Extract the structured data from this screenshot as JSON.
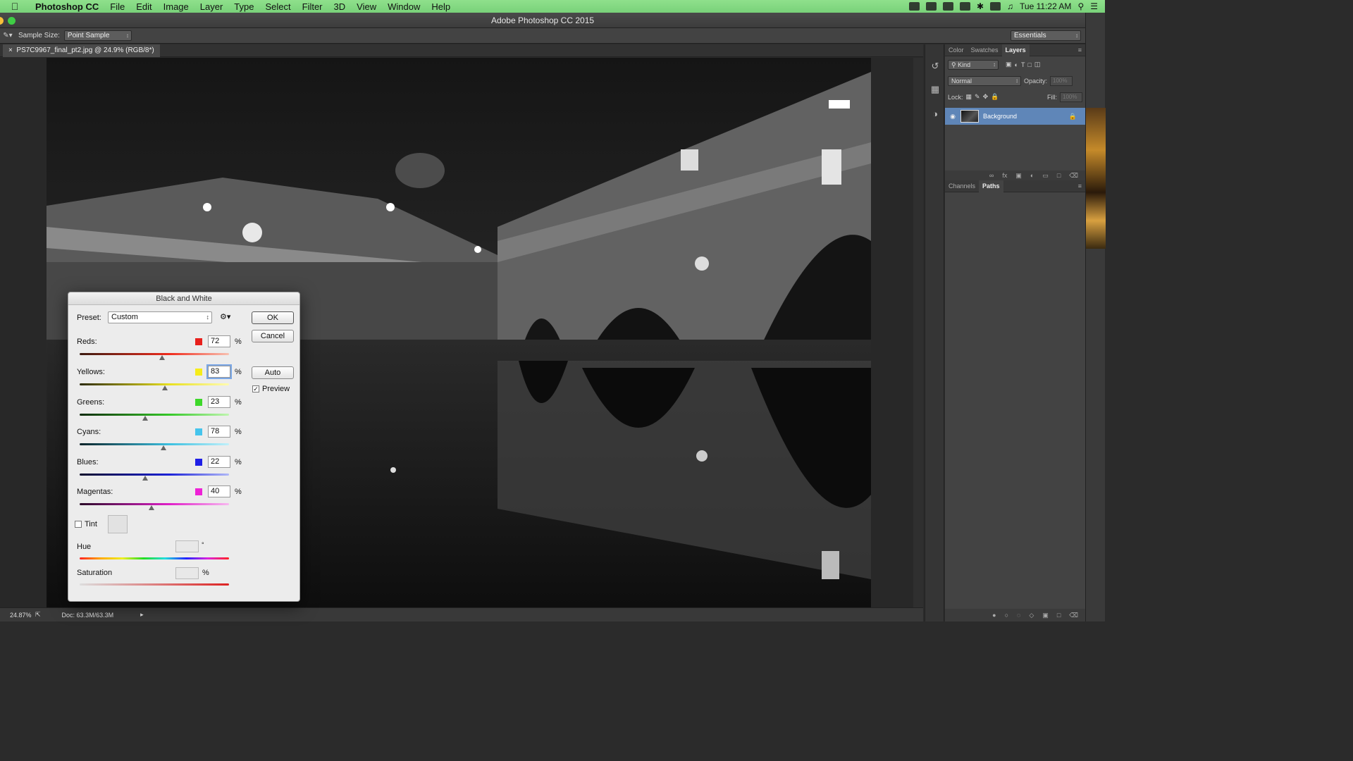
{
  "menubar": {
    "app_name": "Photoshop CC",
    "menus": [
      "File",
      "Edit",
      "Image",
      "Layer",
      "Type",
      "Select",
      "Filter",
      "3D",
      "View",
      "Window",
      "Help"
    ],
    "clock": "Tue 11:22 AM"
  },
  "window": {
    "title": "Adobe Photoshop CC 2015"
  },
  "options_bar": {
    "sample_size_label": "Sample Size:",
    "sample_size_value": "Point Sample",
    "workspace": "Essentials"
  },
  "document": {
    "tab_title": "PS7C9967_final_pt2.jpg @ 24.9% (RGB/8*)",
    "zoom": "24.87%",
    "doc_size": "Doc: 63.3M/63.3M"
  },
  "layers_panel": {
    "tabs": [
      "Color",
      "Swatches",
      "Layers"
    ],
    "filter_kind": "Kind",
    "blend_mode": "Normal",
    "opacity_label": "Opacity:",
    "opacity_value": "100%",
    "lock_label": "Lock:",
    "fill_label": "Fill:",
    "fill_value": "100%",
    "layer_name": "Background"
  },
  "paths_panel": {
    "tabs": [
      "Channels",
      "Paths"
    ]
  },
  "dialog": {
    "title": "Black and White",
    "preset_label": "Preset:",
    "preset_value": "Custom",
    "ok": "OK",
    "cancel": "Cancel",
    "auto": "Auto",
    "preview": "Preview",
    "channels": [
      {
        "label": "Reds:",
        "value": "72",
        "unit": "%",
        "color": "#e8201c",
        "pos": 0.55
      },
      {
        "label": "Yellows:",
        "value": "83",
        "unit": "%",
        "color": "#f6ec1a",
        "pos": 0.57
      },
      {
        "label": "Greens:",
        "value": "23",
        "unit": "%",
        "color": "#3ed82a",
        "pos": 0.44
      },
      {
        "label": "Cyans:",
        "value": "78",
        "unit": "%",
        "color": "#45c4ec",
        "pos": 0.56
      },
      {
        "label": "Blues:",
        "value": "22",
        "unit": "%",
        "color": "#1f1fe6",
        "pos": 0.44
      },
      {
        "label": "Magentas:",
        "value": "40",
        "unit": "%",
        "color": "#ee22d6",
        "pos": 0.48
      }
    ],
    "tint_label": "Tint",
    "hue_label": "Hue",
    "hue_unit": "°",
    "saturation_label": "Saturation",
    "saturation_unit": "%"
  }
}
